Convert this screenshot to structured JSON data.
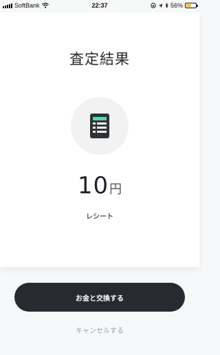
{
  "status_bar": {
    "carrier": "SoftBank",
    "time": "22:37",
    "battery": "56%"
  },
  "result": {
    "title": "査定結果",
    "amount_value": "10",
    "amount_unit": "円",
    "item_name": "レシート"
  },
  "actions": {
    "exchange_label": "お金と交換する",
    "cancel_label": "キャンセルする"
  },
  "colors": {
    "accent": "#59d6a8",
    "button": "#272a2f"
  },
  "icons": [
    "signal-icon",
    "wifi-icon",
    "location-icon",
    "bluetooth-icon",
    "battery-icon",
    "receipt-icon"
  ]
}
